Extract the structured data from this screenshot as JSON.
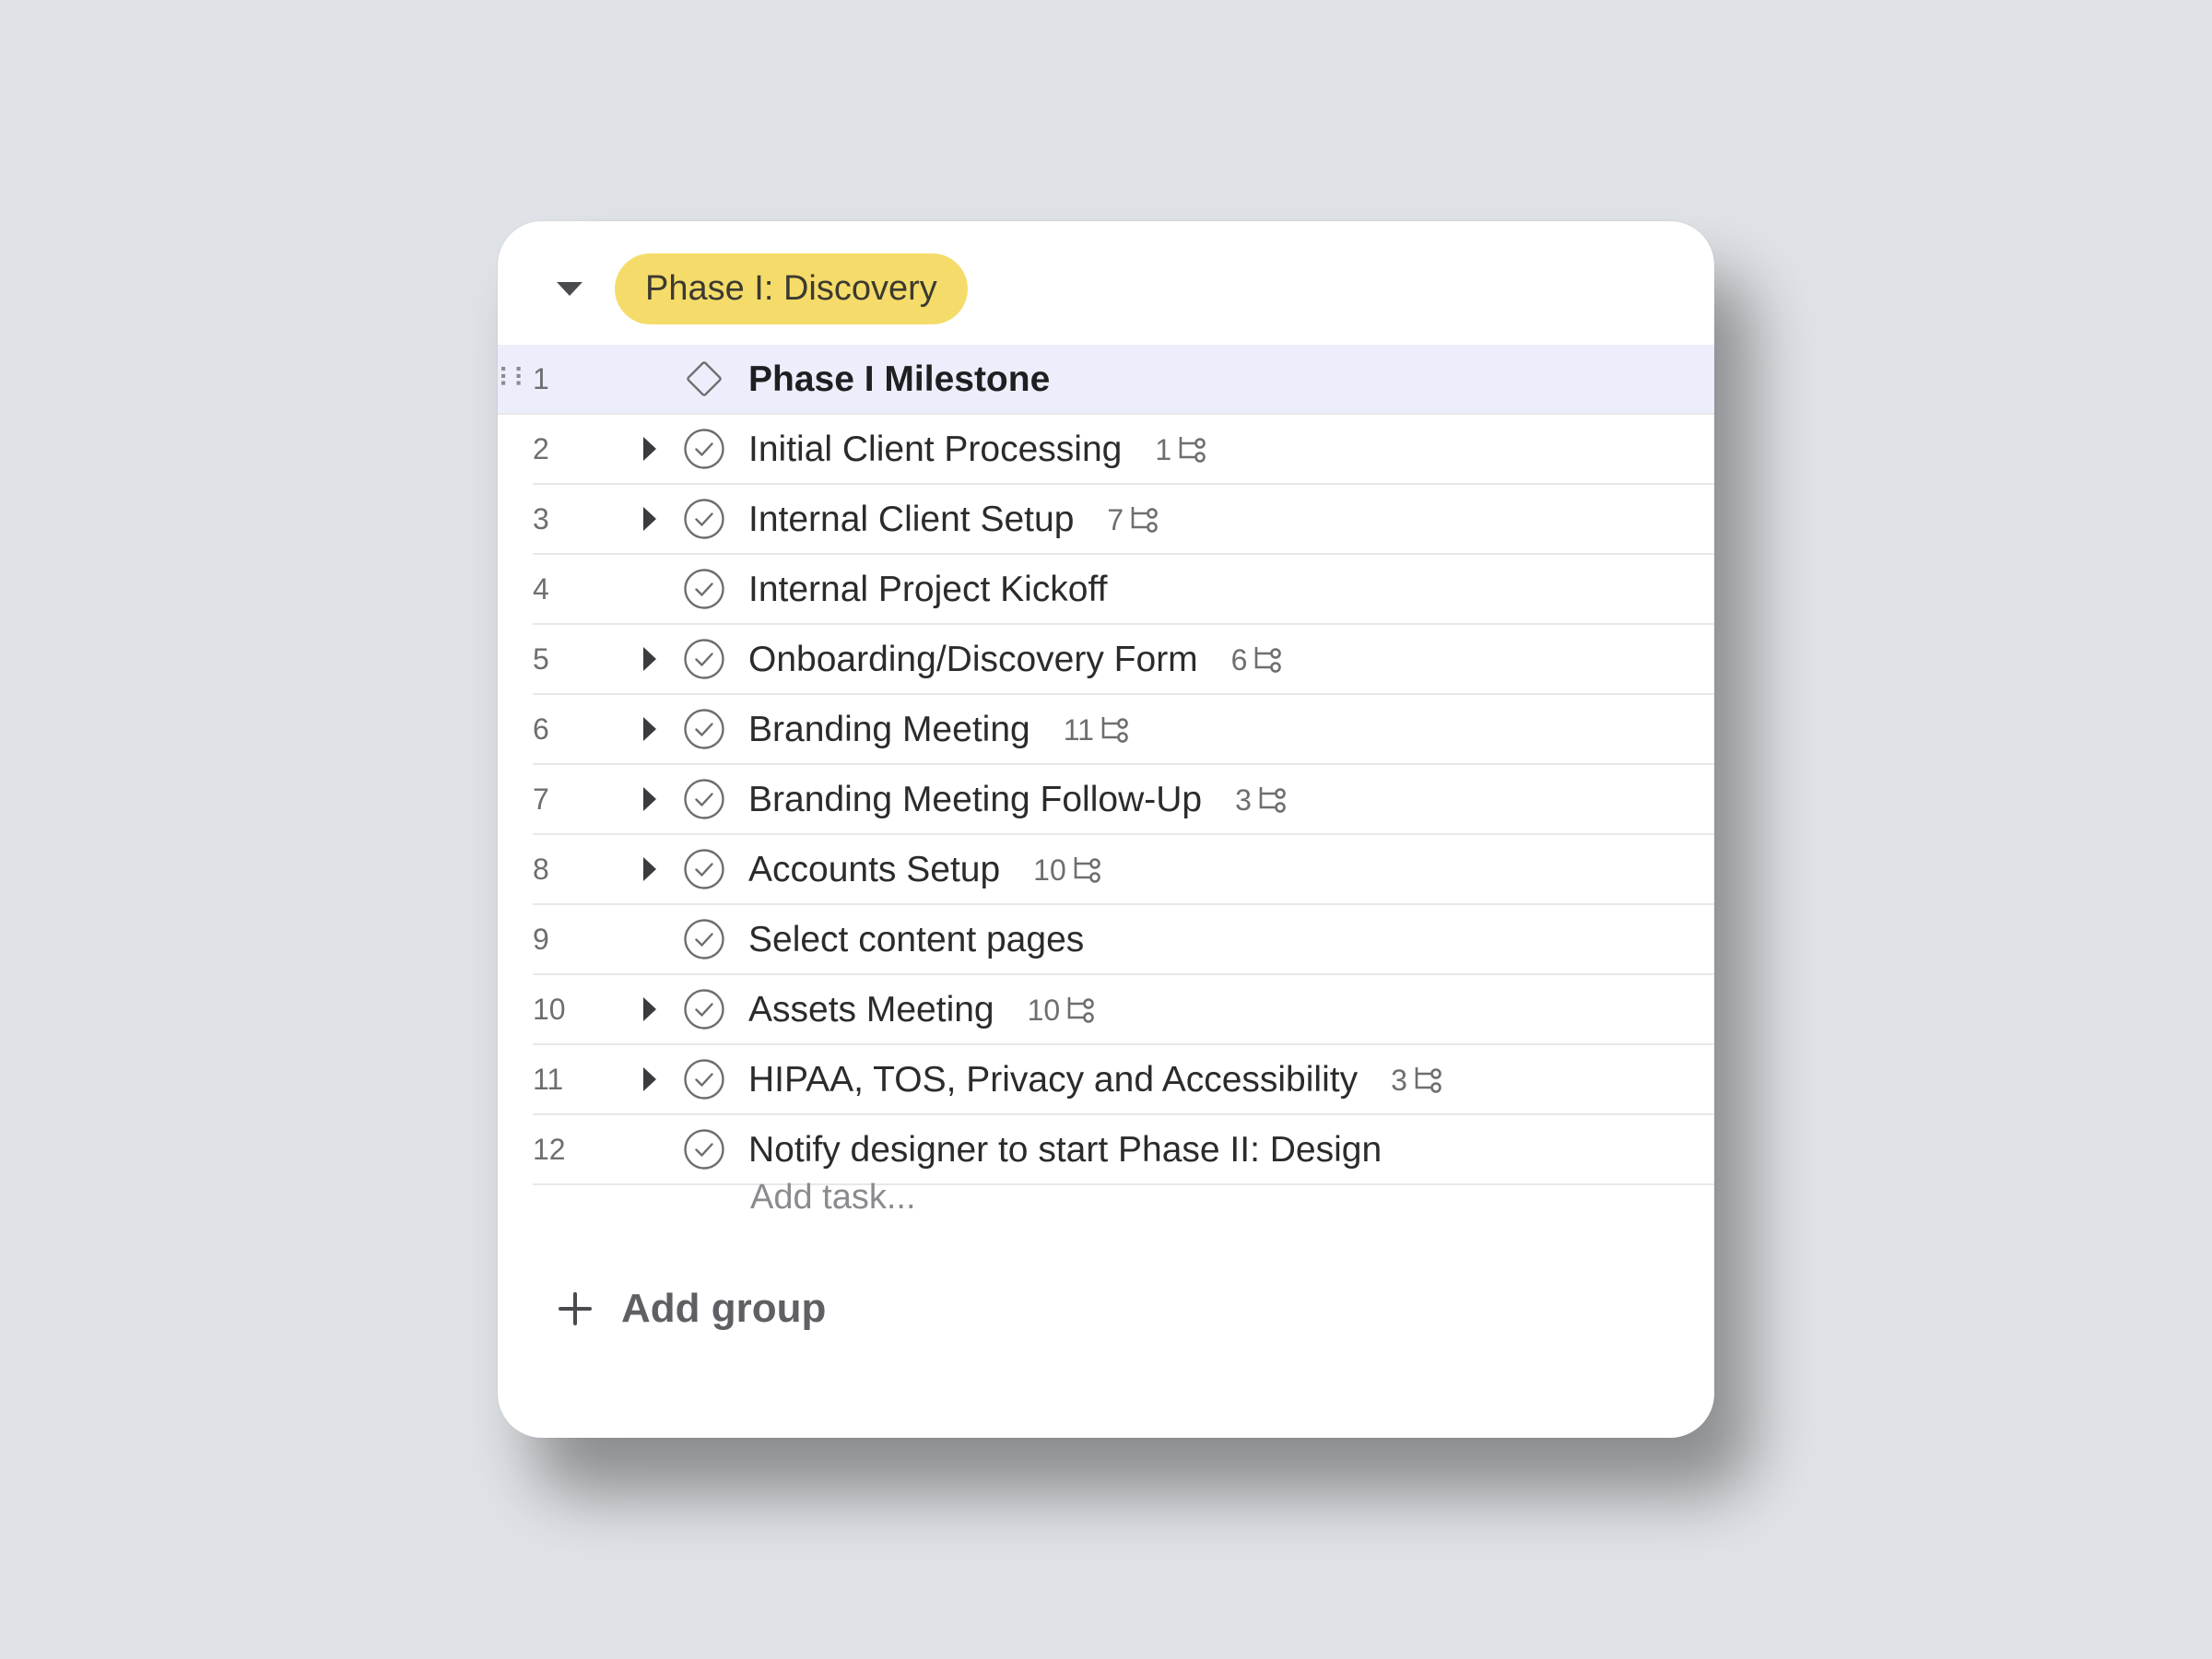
{
  "group": {
    "name": "Phase I: Discovery",
    "pill_color": "#f5dc6a",
    "collapse_icon": "caret-down-icon"
  },
  "tasks": [
    {
      "num": "1",
      "title": "Phase I Milestone",
      "type": "milestone",
      "expandable": false,
      "subtasks": "",
      "highlighted": true
    },
    {
      "num": "2",
      "title": "Initial Client Processing",
      "type": "task",
      "expandable": true,
      "subtasks": "1"
    },
    {
      "num": "3",
      "title": "Internal Client Setup",
      "type": "task",
      "expandable": true,
      "subtasks": "7"
    },
    {
      "num": "4",
      "title": "Internal Project Kickoff",
      "type": "task",
      "expandable": false,
      "subtasks": ""
    },
    {
      "num": "5",
      "title": "Onboarding/Discovery Form",
      "type": "task",
      "expandable": true,
      "subtasks": "6"
    },
    {
      "num": "6",
      "title": "Branding Meeting",
      "type": "task",
      "expandable": true,
      "subtasks": "11"
    },
    {
      "num": "7",
      "title": "Branding Meeting Follow-Up",
      "type": "task",
      "expandable": true,
      "subtasks": "3"
    },
    {
      "num": "8",
      "title": "Accounts Setup",
      "type": "task",
      "expandable": true,
      "subtasks": "10"
    },
    {
      "num": "9",
      "title": "Select content pages",
      "type": "task",
      "expandable": false,
      "subtasks": ""
    },
    {
      "num": "10",
      "title": "Assets Meeting",
      "type": "task",
      "expandable": true,
      "subtasks": "10"
    },
    {
      "num": "11",
      "title": "HIPAA, TOS, Privacy and Accessibility",
      "type": "task",
      "expandable": true,
      "subtasks": "3"
    },
    {
      "num": "12",
      "title": "Notify designer to start Phase II: Design",
      "type": "task",
      "expandable": false,
      "subtasks": ""
    }
  ],
  "add_task_placeholder": "Add task...",
  "add_group_label": "Add group",
  "colors": {
    "background": "#dfe2e6",
    "highlight_row": "#edeefb",
    "icon_gray": "#6d6e6f"
  }
}
